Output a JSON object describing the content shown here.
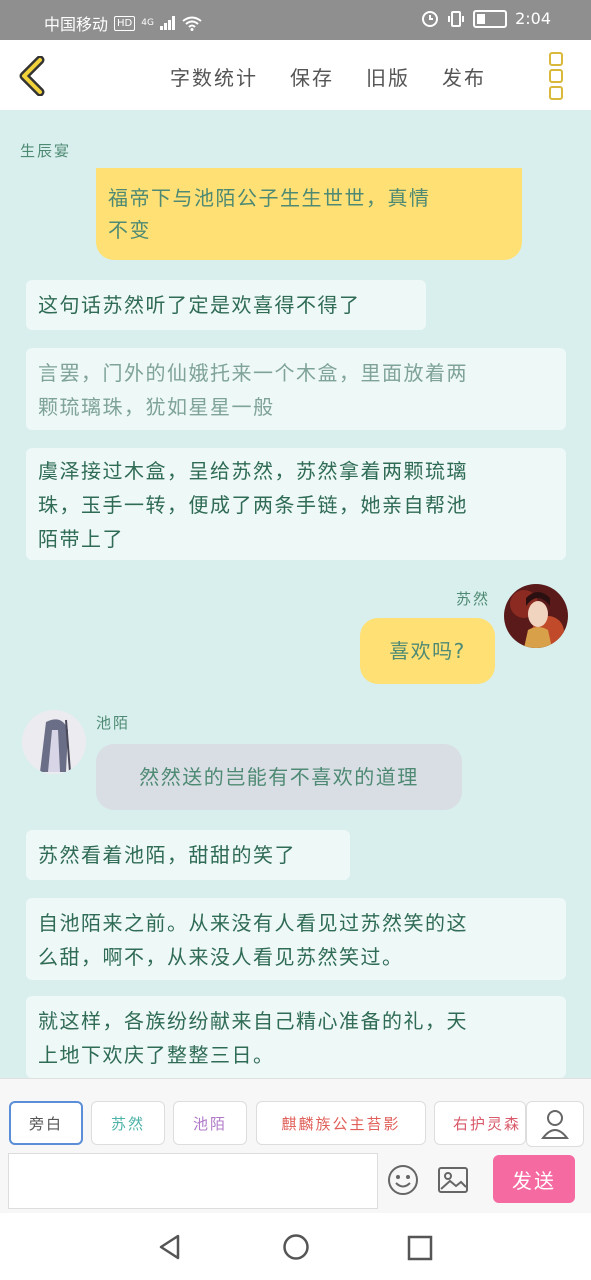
{
  "status_bar": {
    "carrier": "中国移动",
    "hd": "HD",
    "network": "4G",
    "time": "2:04"
  },
  "header": {
    "actions": [
      "字数统计",
      "保存",
      "旧版",
      "发布"
    ],
    "back_icon": "chevron-left-icon",
    "more_icon": "more-vertical-icon",
    "accent_color": "#d8b93c"
  },
  "chat": {
    "speaker_top": "生辰宴",
    "bubble_cut": "福帝下与池陌公子生生世世，真情\n不变",
    "narration_1": "这句话苏然听了定是欢喜得不得了",
    "narration_2": "言罢，门外的仙娥托来一个木盒，里面放着两\n颗琉璃珠，犹如星星一般",
    "narration_3": "虞泽接过木盒，呈给苏然，苏然拿着两颗琉璃\n珠，玉手一转，便成了两条手链，她亲自帮池\n陌带上了",
    "suran_name": "苏然",
    "suran_msg": "喜欢吗?",
    "chimo_name": "池陌",
    "chimo_msg": "然然送的岂能有不喜欢的道理",
    "narration_4": "苏然看着池陌，甜甜的笑了",
    "narration_5": "自池陌来之前。从来没有人看见过苏然笑的这\n么甜，啊不，从来没人看见苏然笑过。",
    "narration_6": "就这样，各族纷纷献来自己精心准备的礼，天\n上地下欢庆了整整三日。"
  },
  "toolbar": {
    "roles": [
      {
        "label": "旁白",
        "color": "#555555"
      },
      {
        "label": "苏然",
        "color": "#4fb3a8"
      },
      {
        "label": "池陌",
        "color": "#b07ac8"
      },
      {
        "label": "麒麟族公主苔影",
        "color": "#e0605a"
      },
      {
        "label": "右护灵森",
        "color": "#d95a6a"
      }
    ],
    "send_label": "发送",
    "send_color": "#f56aa1"
  }
}
